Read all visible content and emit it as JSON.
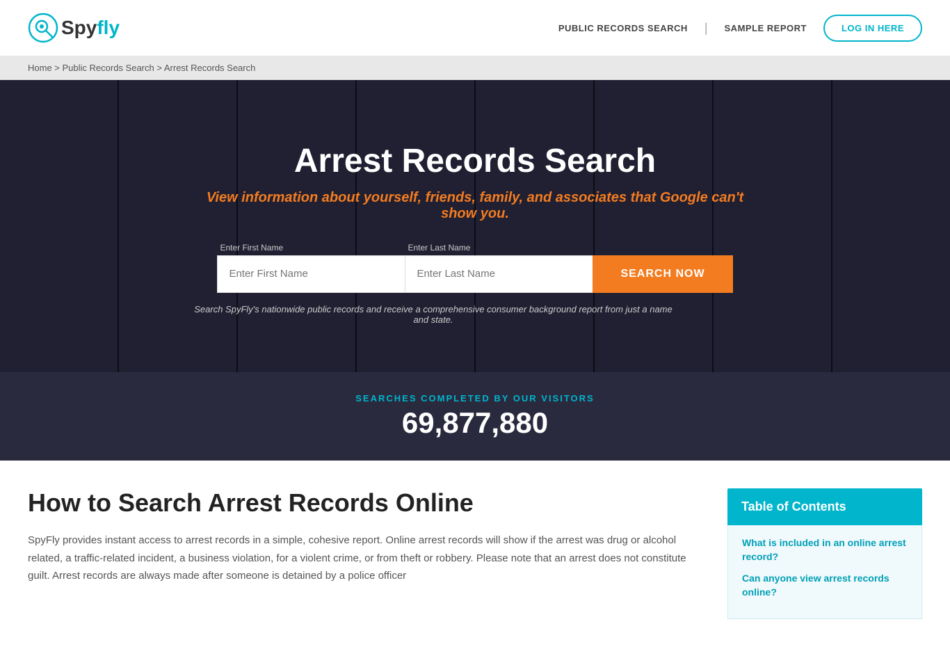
{
  "site": {
    "logo_spy": "Spy",
    "logo_fly": "fly"
  },
  "header": {
    "nav_records": "PUBLIC RECORDS SEARCH",
    "nav_sample": "SAMPLE REPORT",
    "login_label": "LOG IN HERE"
  },
  "breadcrumb": {
    "home": "Home",
    "sep1": " > ",
    "public": "Public Records Search",
    "sep2": " > ",
    "current": "Arrest Records Search"
  },
  "hero": {
    "title": "Arrest Records Search",
    "subtitle": "View information about yourself, friends, family, and associates that Google can't show you.",
    "first_name_label": "Enter First Name",
    "first_name_placeholder": "Enter First Name",
    "last_name_label": "Enter Last Name",
    "last_name_placeholder": "Enter Last Name",
    "search_btn": "SEARCH NOW",
    "disclaimer": "Search SpyFly's nationwide public records and receive a comprehensive consumer background report from just a name and state."
  },
  "stats": {
    "label": "SEARCHES COMPLETED BY OUR VISITORS",
    "number": "69,877,880"
  },
  "main_content": {
    "heading": "How to Search Arrest Records Online",
    "paragraph": "SpyFly provides instant access to arrest records in a simple, cohesive report. Online arrest records will show if the arrest was drug or alcohol related, a traffic-related incident, a business violation, for a violent crime, or from theft or robbery. Please note that an arrest does not constitute guilt. Arrest records are always made after someone is detained by a police officer"
  },
  "toc": {
    "header": "Table of Contents",
    "links": [
      "What is included in an online arrest record?",
      "Can anyone view arrest records online?"
    ]
  }
}
